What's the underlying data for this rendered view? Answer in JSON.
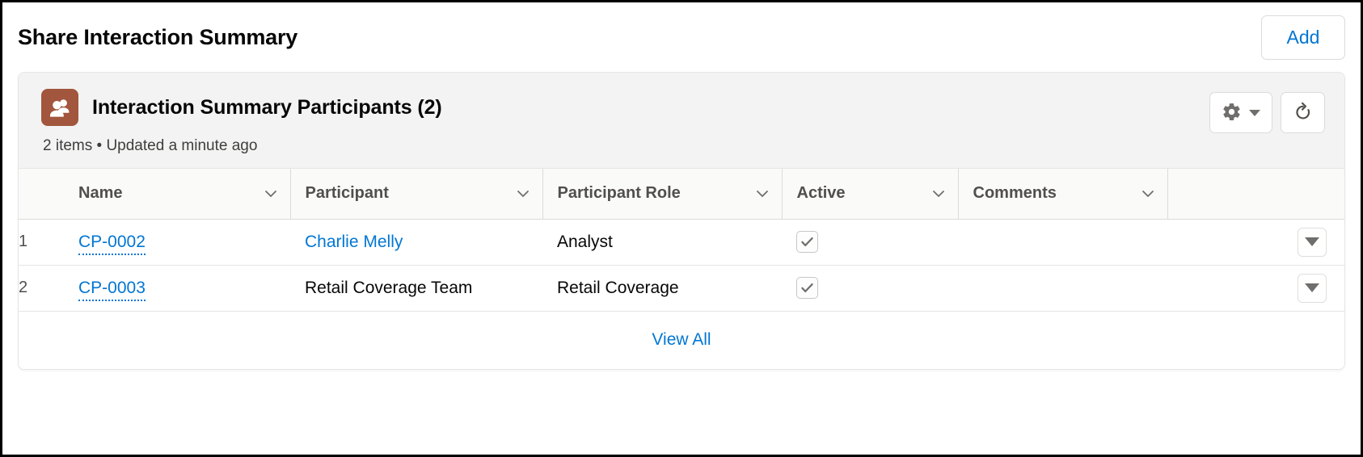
{
  "header": {
    "title": "Share Interaction Summary",
    "add_label": "Add"
  },
  "card": {
    "icon": "people-icon",
    "icon_color": "#a2563d",
    "title": "Interaction Summary Participants (2)",
    "subtitle": "2 items • Updated a minute ago",
    "actions": {
      "settings": "gear-icon",
      "settings_caret": "caret-down-icon",
      "refresh": "refresh-icon"
    }
  },
  "table": {
    "columns": [
      {
        "label": "Name",
        "sortable": true
      },
      {
        "label": "Participant",
        "sortable": true
      },
      {
        "label": "Participant Role",
        "sortable": true
      },
      {
        "label": "Active",
        "sortable": true
      },
      {
        "label": "Comments",
        "sortable": true
      }
    ],
    "rows": [
      {
        "index": "1",
        "name": "CP-0002",
        "name_is_link": true,
        "participant": "Charlie Melly",
        "participant_is_link": true,
        "role": "Analyst",
        "active": true,
        "comments": ""
      },
      {
        "index": "2",
        "name": "CP-0003",
        "name_is_link": true,
        "participant": "Retail Coverage Team",
        "participant_is_link": false,
        "role": "Retail Coverage",
        "active": true,
        "comments": ""
      }
    ]
  },
  "footer": {
    "view_all_label": "View All"
  },
  "colors": {
    "link": "#0176d3",
    "entity_icon": "#a2563d",
    "header_bg": "#f3f3f3"
  }
}
